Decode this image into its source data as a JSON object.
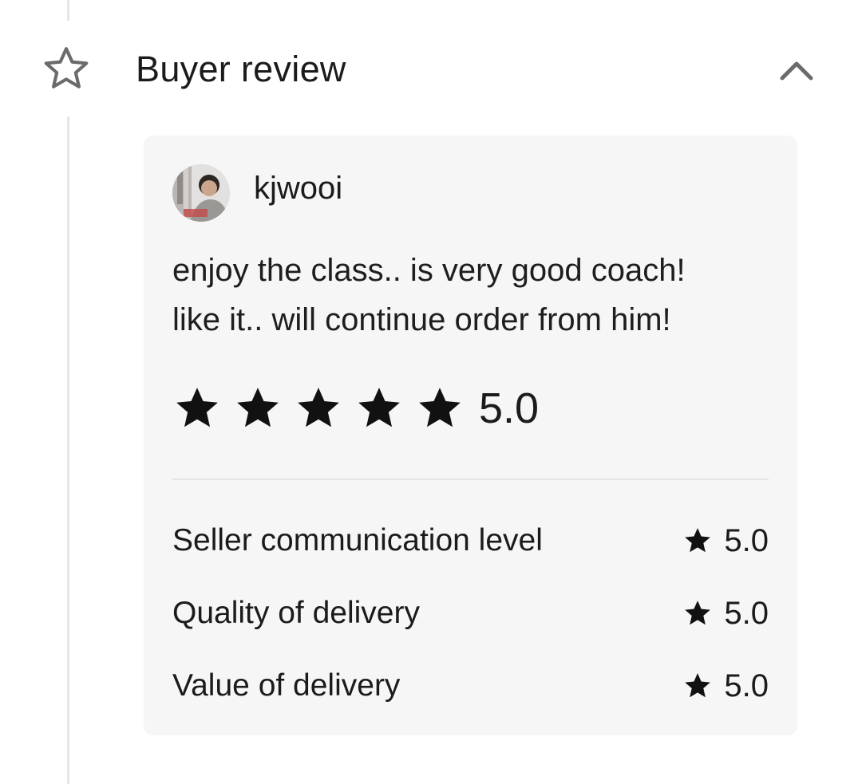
{
  "section": {
    "title": "Buyer review",
    "icon": "star-outline-icon",
    "toggle_icon": "chevron-up-icon"
  },
  "review": {
    "reviewer_name": "kjwooi",
    "text_lines": [
      "enjoy the class.. is very good coach!",
      "like it.. will continue order from him!"
    ],
    "rating": {
      "stars": 5,
      "max_stars": 5,
      "value": "5.0"
    },
    "criteria": [
      {
        "label": "Seller communication level",
        "value": "5.0"
      },
      {
        "label": "Quality of delivery",
        "value": "5.0"
      },
      {
        "label": "Value of delivery",
        "value": "5.0"
      }
    ]
  },
  "colors": {
    "card_background": "#f6f6f7",
    "star_fill": "#111111",
    "icon_gray": "#6b6b6b",
    "divider": "#e4e4e6"
  }
}
